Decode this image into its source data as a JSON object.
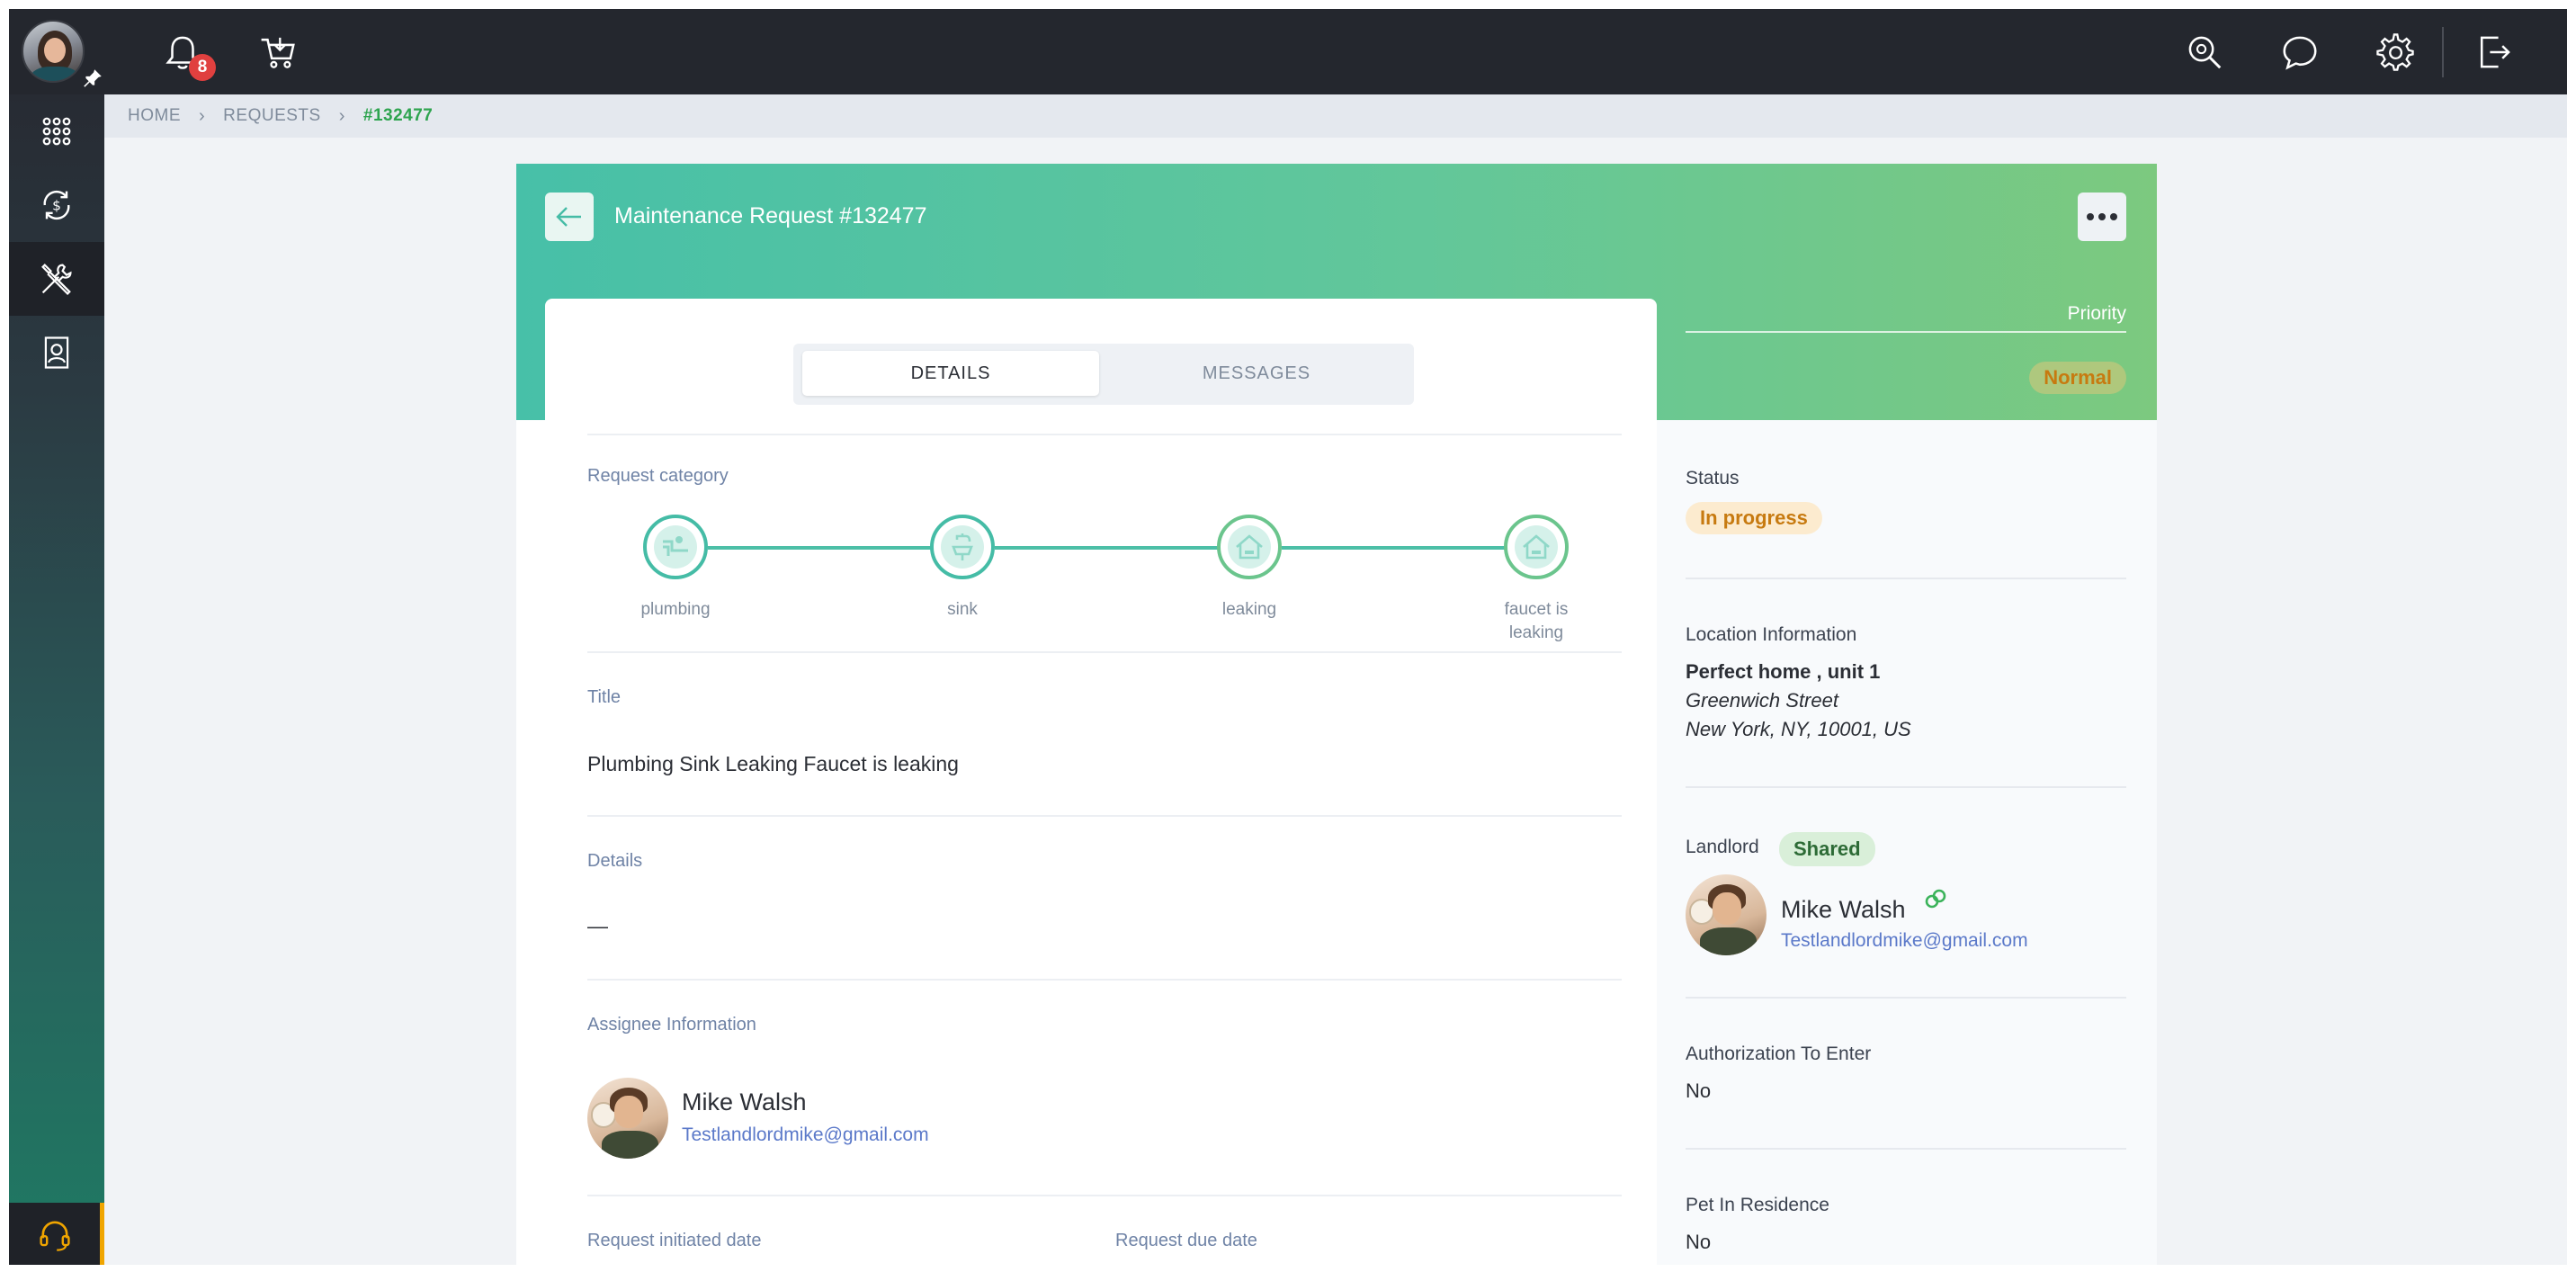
{
  "topbar": {
    "notifications_count": "8",
    "icons": [
      "bell-icon",
      "cart-icon",
      "search-icon",
      "chat-icon",
      "gear-icon",
      "logout-icon"
    ]
  },
  "sidebar": {
    "items": [
      "apps-grid-icon",
      "money-cycle-icon",
      "tools-icon",
      "contact-card-icon"
    ],
    "active": "tools-icon",
    "support_icon": "headset-icon"
  },
  "breadcrumb": {
    "home": "HOME",
    "requests": "REQUESTS",
    "current": "#132477"
  },
  "request": {
    "title": "Maintenance Request #132477",
    "tabs": {
      "details": "DETAILS",
      "messages": "MESSAGES",
      "active": "DETAILS"
    },
    "category_label": "Request category",
    "categories": [
      {
        "label": "plumbing",
        "icon": "pipes-icon"
      },
      {
        "label": "sink",
        "icon": "faucet-icon"
      },
      {
        "label": "leaking",
        "icon": "house-leak-icon"
      },
      {
        "label": "faucet is leaking",
        "icon": "house-leak-icon"
      }
    ],
    "title_label": "Title",
    "title_value": "Plumbing Sink Leaking Faucet is leaking",
    "details_label": "Details",
    "details_value": "—",
    "assignee_label": "Assignee Information",
    "assignee": {
      "name": "Mike Walsh",
      "email": "Testlandlordmike@gmail.com"
    },
    "initiated_label": "Request initiated date",
    "due_label": "Request due date"
  },
  "side": {
    "priority_label": "Priority",
    "priority_value": "Normal",
    "status_label": "Status",
    "status_value": "In progress",
    "location_label": "Location Information",
    "location_name": "Perfect home , unit 1",
    "location_street": "Greenwich Street",
    "location_city": "New York, NY, 10001, US",
    "landlord_label": "Landlord",
    "landlord_badge": "Shared",
    "landlord": {
      "name": "Mike Walsh",
      "email": "Testlandlordmike@gmail.com"
    },
    "auth_label": "Authorization To Enter",
    "auth_value": "No",
    "pet_label": "Pet In Residence",
    "pet_value": "No"
  },
  "colors": {
    "topbar": "#24272e",
    "accent_green": "#45bca6",
    "breadcrumb_current": "#2ea44f",
    "link_blue": "#5b79c9",
    "pill_orange": "#c77a10"
  }
}
